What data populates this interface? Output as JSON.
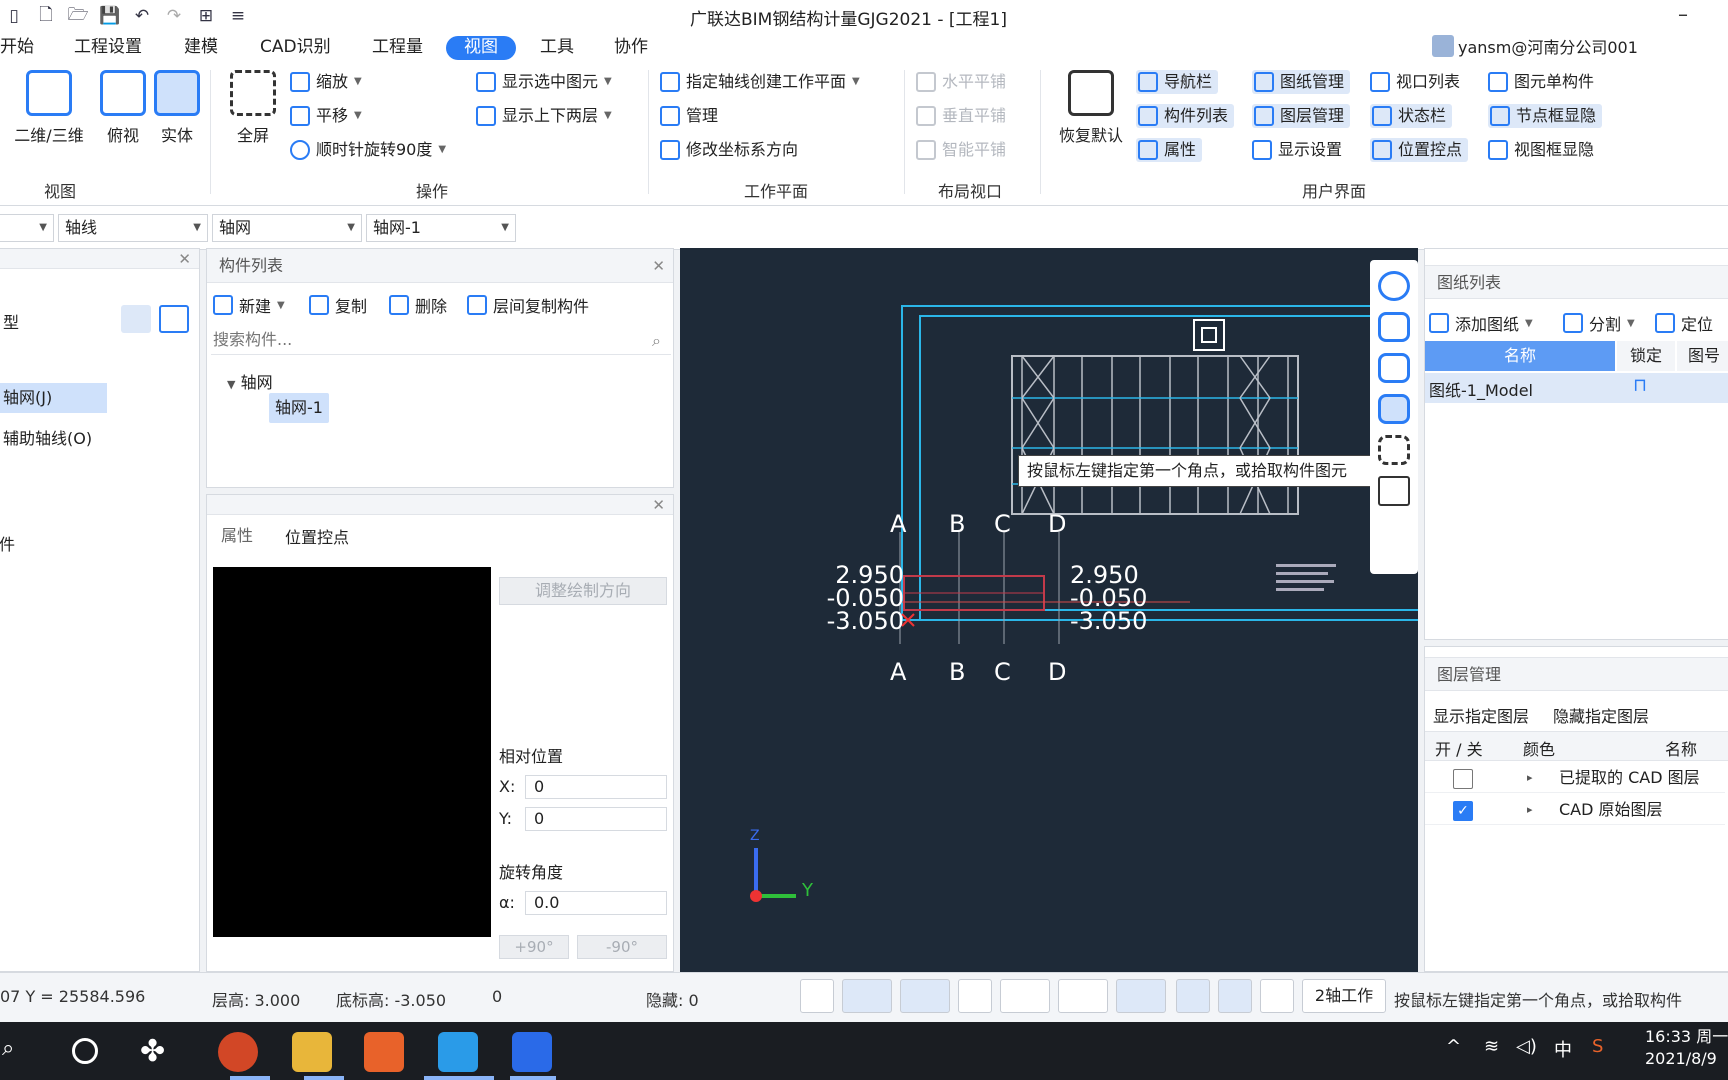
{
  "window": {
    "title": "广联达BIM钢结构计量GJG2021 - [工程1]",
    "minimize": "–"
  },
  "menu": {
    "items": [
      "开始",
      "工程设置",
      "建模",
      "CAD识别",
      "工程量",
      "视图",
      "工具",
      "协作"
    ],
    "active": "视图"
  },
  "user": {
    "name": "yansm@河南分公司001"
  },
  "ribbon": {
    "view_group": {
      "label": "视图",
      "btn_2d3d": "二维/三维",
      "btn_top": "俯视",
      "btn_solid": "实体"
    },
    "ops_group": {
      "label": "操作",
      "fullscreen": "全屏",
      "zoom": "缩放",
      "pan": "平移",
      "rotate": "顺时针旋转90度",
      "show_selected": "显示选中图元",
      "show_updown": "显示上下两层"
    },
    "workplane_group": {
      "label": "工作平面",
      "axis_create": "指定轴线创建工作平面",
      "manage": "管理",
      "modify_coord": "修改坐标系方向"
    },
    "layout_group": {
      "label": "布局视口",
      "h_tile": "水平平铺",
      "v_tile": "垂直平铺",
      "smart_tile": "智能平铺"
    },
    "ui_group": {
      "label": "用户界面",
      "restore": "恢复默认",
      "navbar": "导航栏",
      "drawing_mgr": "图纸管理",
      "viewport_list": "视口列表",
      "elem_single": "图元单构件",
      "comp_list": "构件列表",
      "layer_mgr": "图层管理",
      "statusbar": "状态栏",
      "node_frame": "节点框显隐",
      "props": "属性",
      "display_settings": "显示设置",
      "pos_control": "位置控点",
      "view_frame": "视图框显隐"
    }
  },
  "selectors": {
    "s1": "轴线",
    "s2": "轴网",
    "s3": "轴网-1"
  },
  "left_panel": {
    "type_label": "型",
    "items": [
      "轴网(J)",
      "辅助轴线(O)"
    ],
    "partial": "件"
  },
  "component_list": {
    "title": "构件列表",
    "new": "新建",
    "copy": "复制",
    "delete": "删除",
    "floor_copy": "层间复制构件",
    "search_placeholder": "搜索构件...",
    "tree_parent": "轴网",
    "tree_child": "轴网-1"
  },
  "props_panel": {
    "tab_props": "属性",
    "tab_pos": "位置控点",
    "adjust_dir": "调整绘制方向",
    "rel_pos": "相对位置",
    "x_label": "X:",
    "x_value": "0",
    "y_label": "Y:",
    "y_value": "0",
    "rot_angle": "旋转角度",
    "alpha_label": "α:",
    "alpha_value": "0.0",
    "plus90": "+90°",
    "minus90": "-90°"
  },
  "canvas": {
    "tooltip": "按鼠标左键指定第一个角点，或拾取构件图元",
    "axis_top": [
      "A",
      "B",
      "C",
      "D"
    ],
    "axis_bottom": [
      "A",
      "B",
      "C",
      "D"
    ],
    "elev_left": [
      "2.950",
      "-0.050",
      "-3.050"
    ],
    "elev_right": [
      "2.950",
      "-0.050",
      "-3.050"
    ],
    "ucs_y": "Y",
    "ucs_z": "Z"
  },
  "drawing_list": {
    "title": "图纸列表",
    "add": "添加图纸",
    "split": "分割",
    "locate": "定位",
    "col_name": "名称",
    "col_lock": "锁定",
    "col_num": "图号",
    "row": "图纸-1_Model"
  },
  "layer_panel": {
    "title": "图层管理",
    "show_layer": "显示指定图层",
    "hide_layer": "隐藏指定图层",
    "col_onoff": "开 / 关",
    "col_color": "颜色",
    "col_name": "名称",
    "rows": [
      {
        "name": "已提取的 CAD 图层",
        "checked": false
      },
      {
        "name": "CAD 原始图层",
        "checked": true
      }
    ]
  },
  "status": {
    "coords": "07 Y = 25584.596",
    "floor_h": "层高: 3.000",
    "bottom_h": "底标高: -3.050",
    "zero": "0",
    "hidden": "隐藏: 0",
    "axis_work": "2轴工作",
    "hint": "按鼠标左键指定第一个角点，或拾取构件"
  },
  "taskbar": {
    "time": "16:33",
    "weekday": "周一",
    "date": "2021/8/9",
    "ime": "中"
  },
  "colors": {
    "accent": "#2a7cf5",
    "canvas_bg": "#1e2a38",
    "cyan_line": "#2bb6e8",
    "grid_line": "#b9bec6"
  }
}
